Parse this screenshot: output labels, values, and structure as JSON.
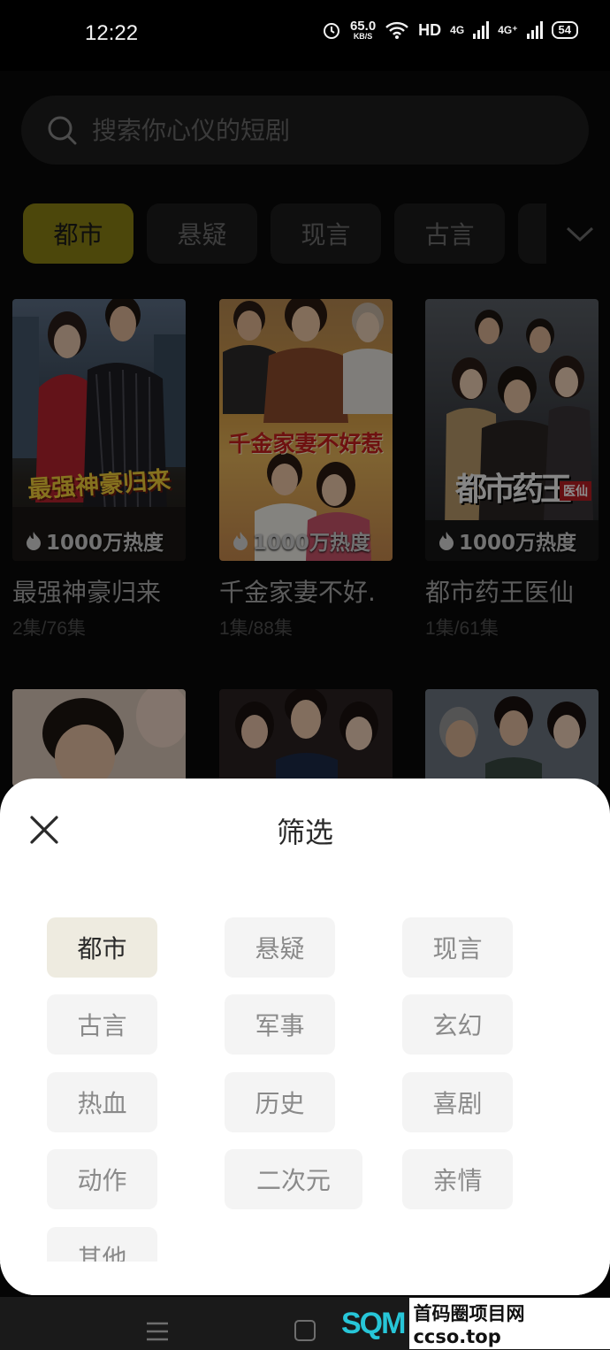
{
  "status": {
    "time": "12:22",
    "speed_value": "65.0",
    "speed_unit": "KB/S",
    "hd": "HD",
    "net1": "4G",
    "net2": "4G⁺",
    "battery": "54"
  },
  "search": {
    "placeholder": "搜索你心仪的短剧"
  },
  "tabs": [
    "都市",
    "悬疑",
    "现言",
    "古言",
    ""
  ],
  "cards": [
    {
      "title": "最强神豪归来",
      "episodes": "2集/76集",
      "heat": "1000万热度",
      "poster_text": "最强神豪归来"
    },
    {
      "title": "千金家妻不好.",
      "episodes": "1集/88集",
      "heat": "1000万热度",
      "poster_text": "千金家妻不好惹"
    },
    {
      "title": "都市药王医仙",
      "episodes": "1集/61集",
      "heat": "1000万热度",
      "poster_text": "都市药王",
      "poster_badge": "医仙"
    }
  ],
  "sheet": {
    "title": "筛选",
    "options": [
      "都市",
      "悬疑",
      "现言",
      "古言",
      "军事",
      "玄幻",
      "热血",
      "历史",
      "喜剧",
      "动作",
      "二次元",
      "亲情",
      "其他"
    ],
    "selected": "都市"
  },
  "watermark": {
    "logo": "SQM",
    "text": "首码圈项目网 ccso.top"
  },
  "colors": {
    "accent": "#8a8214",
    "chip_selected_bg": "#eeebe0",
    "watermark": "#27c6d8"
  }
}
